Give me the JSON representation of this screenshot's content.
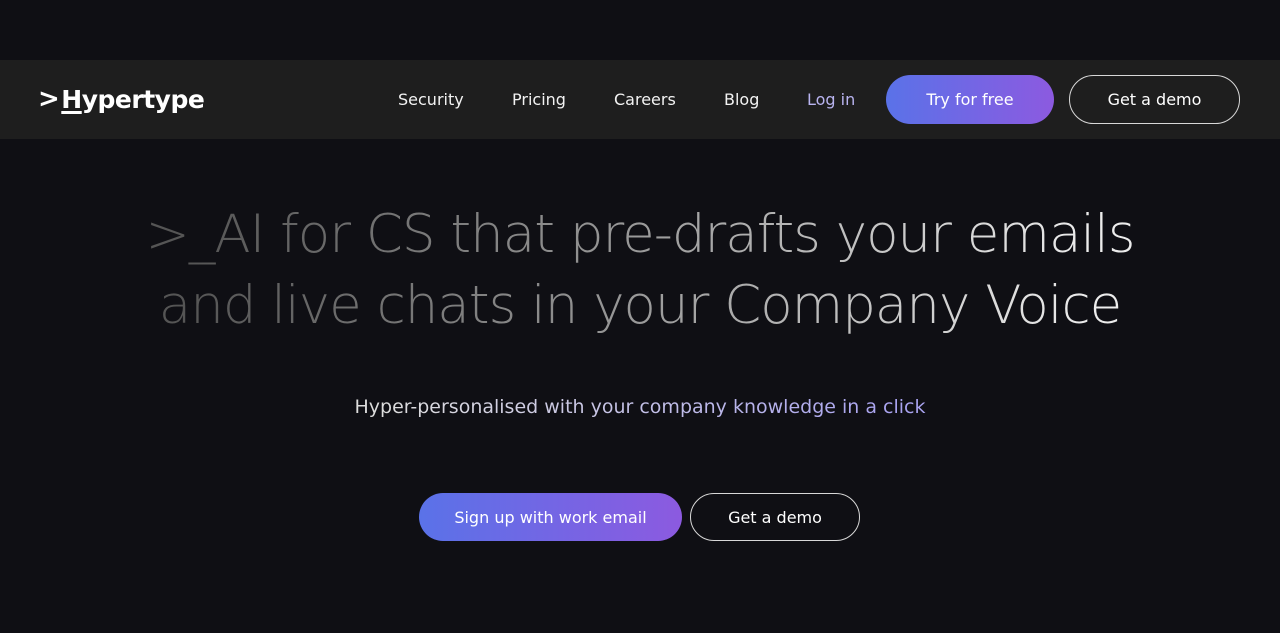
{
  "nav": {
    "logo": "Hypertype",
    "logo_prefix": ">",
    "links": [
      "Security",
      "Pricing",
      "Careers",
      "Blog",
      "Log in"
    ],
    "try_free": "Try for free",
    "get_demo": "Get a demo"
  },
  "hero": {
    "line1": ">_AI for CS that pre-drafts your emails",
    "line2": "and live chats in your Company Voice",
    "subtitle": "Hyper-personalised with your company knowledge in a click",
    "signup": "Sign up with work email",
    "demo": "Get a demo"
  },
  "colors": {
    "background": "#0f0f14",
    "nav": "#1e1e1e",
    "accent_start": "#5a72e8",
    "accent_end": "#8c5ae0"
  }
}
